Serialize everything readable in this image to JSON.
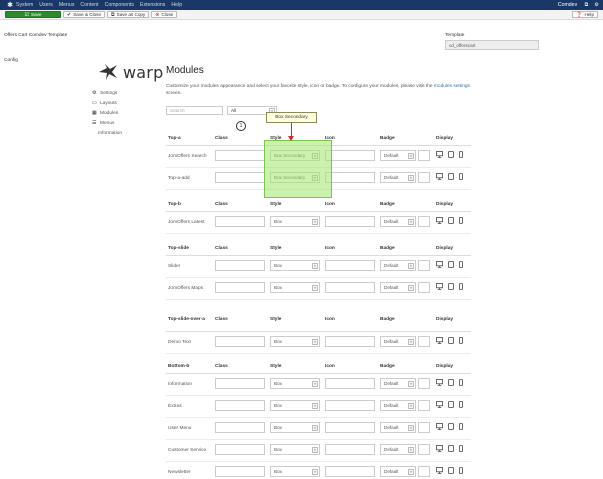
{
  "navbar": {
    "items": [
      "System",
      "Users",
      "Menus",
      "Content",
      "Components",
      "Extensions",
      "Help"
    ],
    "user": "Comdev",
    "icons": {
      "joomla": "joomla-icon",
      "external": "external-link-icon",
      "gear": "gear-icon"
    }
  },
  "toolbar": {
    "save": "Save",
    "save_close": "Save & Close",
    "save_copy": "Save as Copy",
    "close": "Close",
    "help": "Help"
  },
  "page": {
    "title": "Offers Cart Comdev Template",
    "template_label": "Template",
    "template_value": "cd_offerscart",
    "tab": "Config"
  },
  "sidebar": {
    "logo_word": "warp",
    "items": [
      {
        "label": "Settings",
        "icon": "settings-icon"
      },
      {
        "label": "Layouts",
        "icon": "layouts-icon"
      },
      {
        "label": "Modules",
        "icon": "modules-icon"
      },
      {
        "label": "Menus",
        "icon": "menus-icon"
      },
      {
        "label": "Information",
        "icon": ""
      }
    ]
  },
  "main": {
    "title": "Modules",
    "desc_text": "Customize your modules appearance and select your favorite style, icon or badge. To configure your modules, please visit the",
    "desc_link": "modules settings",
    "desc_end": " screen.",
    "search_placeholder": "Search",
    "filter_value": "All",
    "tooltip": "Box Secondary",
    "marker": "1"
  },
  "columns": {
    "class": "Class",
    "style": "Style",
    "icon": "Icon",
    "badge": "Badge",
    "display": "Display"
  },
  "accent": {
    "save_green": "#2b8a2b",
    "navbar_blue": "#1a3867",
    "annotation_red": "#d9262c",
    "highlight_green": "#a0e66e"
  },
  "tables": [
    {
      "position": "Top-a",
      "rows": [
        {
          "name": "JomOffers Search",
          "style": "Box Secondary",
          "badge": "Default"
        },
        {
          "name": "Top-a-add",
          "style": "Box Secondary",
          "badge": "Default"
        }
      ]
    },
    {
      "position": "Top-b",
      "rows": [
        {
          "name": "JomOffers Latest",
          "style": "Box",
          "badge": "Default"
        }
      ]
    },
    {
      "position": "Top-slide",
      "rows": [
        {
          "name": "Slider",
          "style": "Box",
          "badge": "Default"
        },
        {
          "name": "JomOffers Maps",
          "style": "Box",
          "badge": "Default"
        }
      ]
    },
    {
      "position": "Top-slide-over-a",
      "rows": [
        {
          "name": "Demo Text",
          "style": "Box",
          "badge": "Default"
        }
      ]
    },
    {
      "position": "Bottom-b",
      "rows": [
        {
          "name": "Information",
          "style": "Box",
          "badge": "Default"
        },
        {
          "name": "Extras",
          "style": "Box",
          "badge": "Default"
        },
        {
          "name": "User Menu",
          "style": "Box",
          "badge": "Default"
        },
        {
          "name": "Customer Service",
          "style": "Box",
          "badge": "Default"
        },
        {
          "name": "Newsletter",
          "style": "Box",
          "badge": "Default"
        }
      ]
    }
  ]
}
